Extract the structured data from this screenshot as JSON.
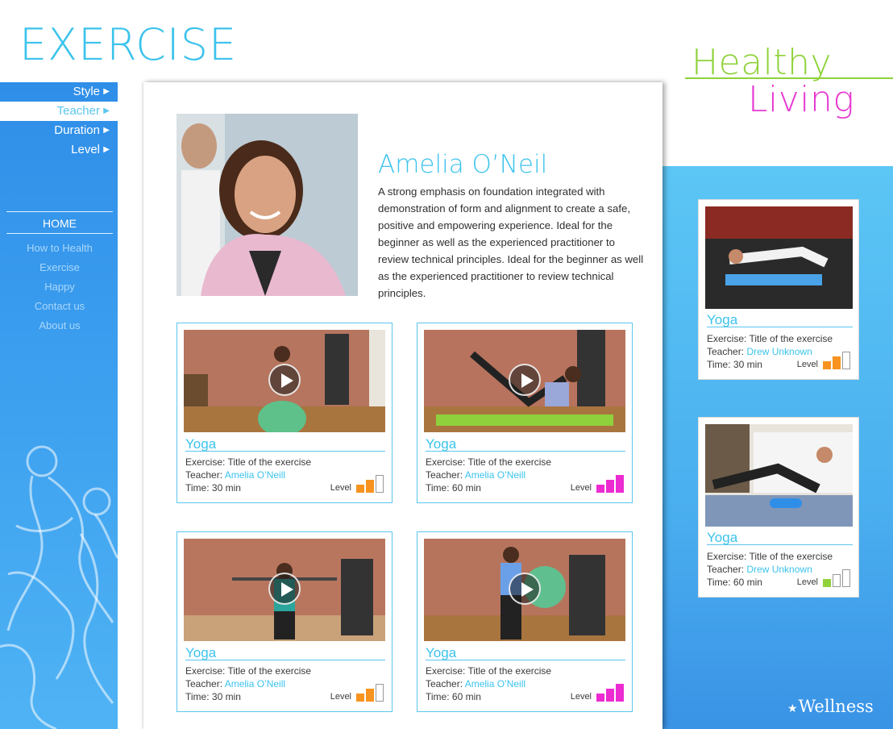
{
  "page_title": "EXERCISE",
  "filters": [
    {
      "label": "Style",
      "active": false
    },
    {
      "label": "Teacher",
      "active": true
    },
    {
      "label": "Duration",
      "active": false
    },
    {
      "label": "Level",
      "active": false
    }
  ],
  "nav": {
    "home": "HOME",
    "items": [
      "How to Health",
      "Exercise",
      "Happy",
      "Contact us",
      "About us"
    ]
  },
  "brand": {
    "healthy": "Healthy",
    "living": "Living",
    "footer": "Wellness"
  },
  "teacher": {
    "name": "Amelia O’Neil",
    "bio": "A strong emphasis on foundation integrated with demonstration of form and alignment to create a safe, positive and empowering experience. Ideal for the beginner as well as the experienced practitioner to review technical principles. Ideal for the beginner as well as the experienced practitioner to review technical principles."
  },
  "labels": {
    "exercise": "Exercise:",
    "teacher": "Teacher:",
    "time": "Time:",
    "level": "Level"
  },
  "exercise_cards": [
    {
      "title": "Yoga",
      "exercise": "Title of the exercise",
      "teacher": "Amelia O’Neill",
      "time": "30 min",
      "level": 2,
      "level_color": "#f7931e"
    },
    {
      "title": "Yoga",
      "exercise": "Title of the exercise",
      "teacher": "Amelia O’Neill",
      "time": "60 min",
      "level": 3,
      "level_color": "#ec2bd1"
    },
    {
      "title": "Yoga",
      "exercise": "Title of the exercise",
      "teacher": "Amelia O’Neill",
      "time": "30 min",
      "level": 2,
      "level_color": "#f7931e"
    },
    {
      "title": "Yoga",
      "exercise": "Title of the exercise",
      "teacher": "Amelia O’Neill",
      "time": "60 min",
      "level": 3,
      "level_color": "#ec2bd1"
    }
  ],
  "side_cards": [
    {
      "title": "Yoga",
      "exercise": "Title of the exercise",
      "teacher": "Drew Unknown",
      "time": "30 min",
      "level": 2,
      "level_color": "#f7931e"
    },
    {
      "title": "Yoga",
      "exercise": "Title of the exercise",
      "teacher": "Drew Unknown",
      "time": "60 min",
      "level": 1,
      "level_color": "#8fd23a"
    }
  ],
  "colors": {
    "accent": "#3cc3ec",
    "nav_blue": "#2f8ee8",
    "green": "#8fd23a",
    "magenta": "#e637d2"
  }
}
